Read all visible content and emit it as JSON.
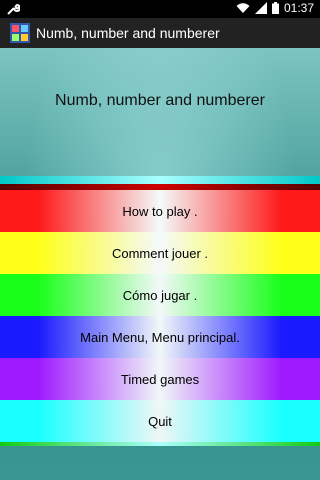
{
  "status_bar": {
    "time": "01:37",
    "icons": [
      "wrench-icon",
      "wifi-icon",
      "signal-icon",
      "battery-icon"
    ]
  },
  "action_bar": {
    "title": "Numb, number and numberer",
    "icon": "app-icon"
  },
  "main": {
    "heading": "Numb, number and numberer",
    "buttons": [
      {
        "label": "How to play .",
        "color": "#ff1a1a"
      },
      {
        "label": "Comment jouer .",
        "color": "#ffff1a"
      },
      {
        "label": "Cómo jugar .",
        "color": "#1aff1a"
      },
      {
        "label": "Main Menu, Menu principal.",
        "color": "#1a1aff"
      },
      {
        "label": "Timed games",
        "color": "#a01aff"
      },
      {
        "label": "Quit",
        "color": "#1affff"
      }
    ]
  },
  "colors": {
    "background": "#2f8a87",
    "action_bar": "#222222",
    "status_bar": "#000000"
  }
}
